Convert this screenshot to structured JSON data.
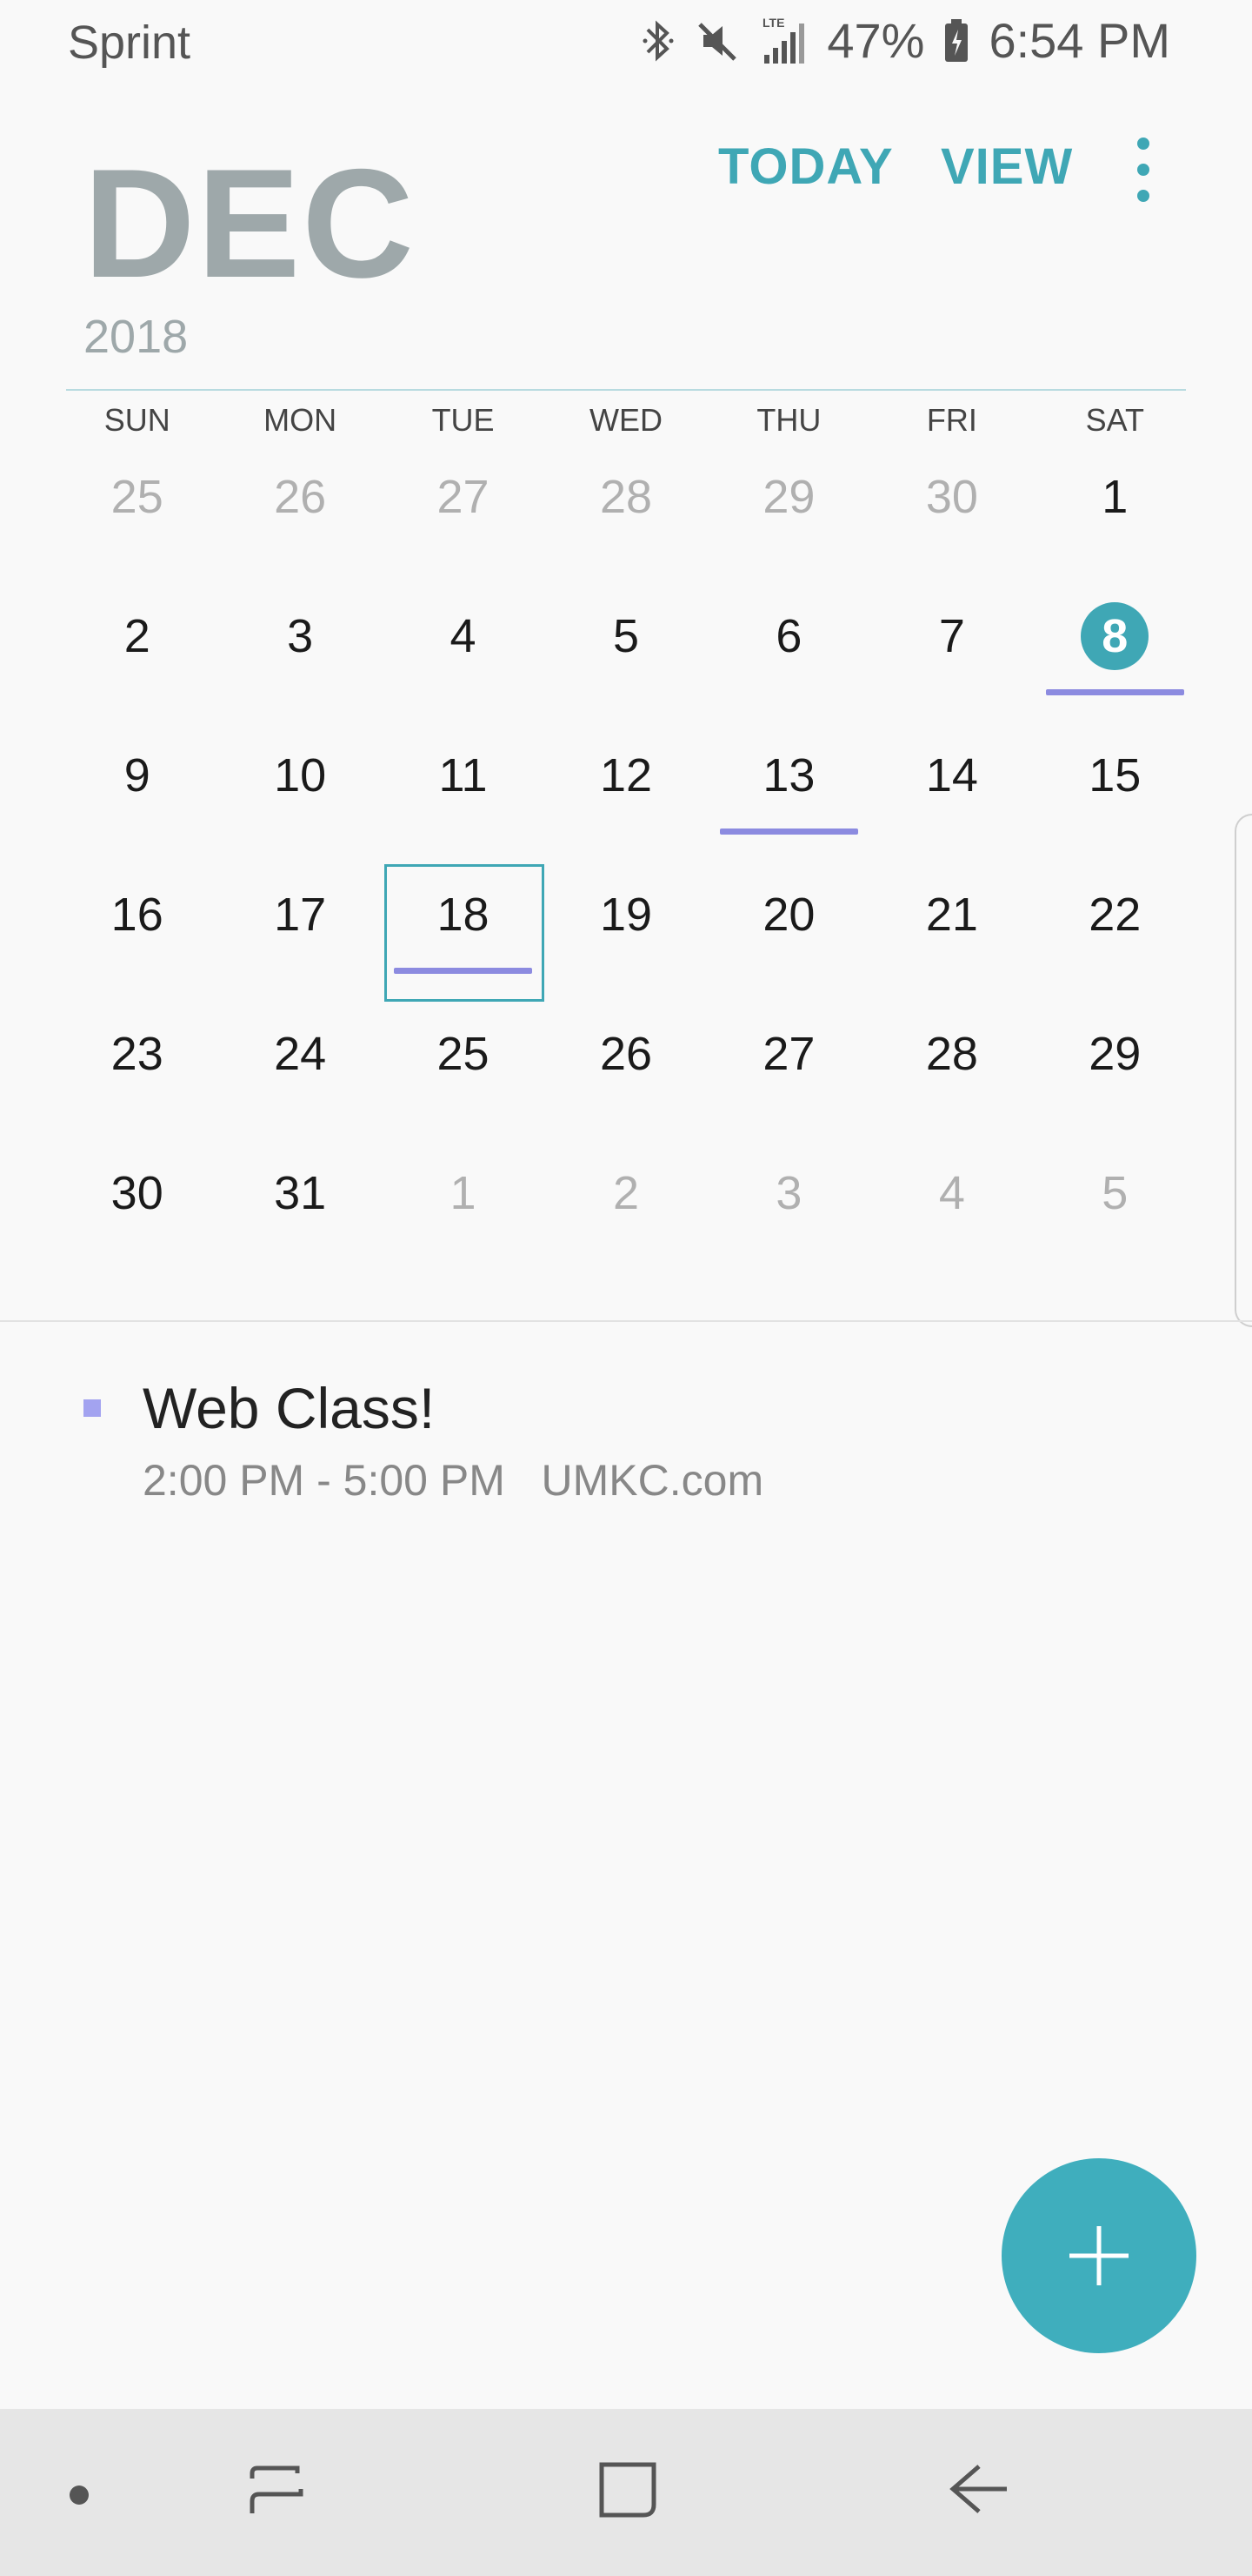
{
  "status_bar": {
    "carrier": "Sprint",
    "battery": "47%",
    "time": "6:54 PM",
    "network": "LTE",
    "icons": [
      "bluetooth-icon",
      "mute-icon",
      "signal-icon",
      "battery-icon"
    ]
  },
  "header": {
    "month": "DEC",
    "year": "2018",
    "today_label": "TODAY",
    "view_label": "VIEW",
    "more_icon": "more-vert-icon"
  },
  "calendar": {
    "weekdays": [
      "SUN",
      "MON",
      "TUE",
      "WED",
      "THU",
      "FRI",
      "SAT"
    ],
    "today": "8",
    "selected": "18",
    "weeks": [
      [
        {
          "d": "25",
          "o": true
        },
        {
          "d": "26",
          "o": true
        },
        {
          "d": "27",
          "o": true
        },
        {
          "d": "28",
          "o": true
        },
        {
          "d": "29",
          "o": true
        },
        {
          "d": "30",
          "o": true
        },
        {
          "d": "1"
        }
      ],
      [
        {
          "d": "2"
        },
        {
          "d": "3"
        },
        {
          "d": "4"
        },
        {
          "d": "5"
        },
        {
          "d": "6"
        },
        {
          "d": "7"
        },
        {
          "d": "8",
          "today": true,
          "event": true
        }
      ],
      [
        {
          "d": "9"
        },
        {
          "d": "10"
        },
        {
          "d": "11"
        },
        {
          "d": "12"
        },
        {
          "d": "13",
          "event": true
        },
        {
          "d": "14"
        },
        {
          "d": "15"
        }
      ],
      [
        {
          "d": "16"
        },
        {
          "d": "17"
        },
        {
          "d": "18",
          "selected": true,
          "event": true
        },
        {
          "d": "19"
        },
        {
          "d": "20"
        },
        {
          "d": "21"
        },
        {
          "d": "22"
        }
      ],
      [
        {
          "d": "23"
        },
        {
          "d": "24"
        },
        {
          "d": "25"
        },
        {
          "d": "26"
        },
        {
          "d": "27"
        },
        {
          "d": "28"
        },
        {
          "d": "29"
        }
      ],
      [
        {
          "d": "30"
        },
        {
          "d": "31"
        },
        {
          "d": "1",
          "o": true
        },
        {
          "d": "2",
          "o": true
        },
        {
          "d": "3",
          "o": true
        },
        {
          "d": "4",
          "o": true
        },
        {
          "d": "5",
          "o": true
        }
      ]
    ]
  },
  "events": [
    {
      "title": "Web Class!",
      "time": "2:00 PM - 5:00 PM",
      "location": "UMKC.com",
      "color": "#a3a3f0"
    }
  ],
  "fab": {
    "icon": "plus-icon",
    "color": "#3faebd"
  },
  "nav_bar": {
    "icons": [
      "nav-dot-icon",
      "recents-icon",
      "home-icon",
      "back-icon"
    ]
  },
  "colors": {
    "accent": "#3fa7b5",
    "event_bar": "#8c8be0",
    "muted": "#9ea8aa"
  }
}
